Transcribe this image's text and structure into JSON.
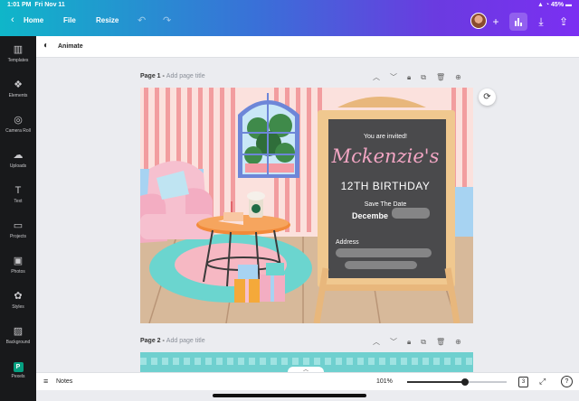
{
  "status": {
    "time": "1:01 PM",
    "date": "Fri Nov 11",
    "battery": "45%"
  },
  "topbar": {
    "back_icon": "chevron-left-icon",
    "home_label": "Home",
    "file_label": "File",
    "resize_label": "Resize",
    "undo_icon": "undo-icon",
    "redo_icon": "redo-icon",
    "add_icon": "plus-icon",
    "insights_icon": "bar-chart-icon",
    "download_icon": "download-icon",
    "share_icon": "share-icon"
  },
  "sidebar": {
    "items": [
      {
        "label": "Templates",
        "icon": "templates-icon"
      },
      {
        "label": "Elements",
        "icon": "elements-icon"
      },
      {
        "label": "Camera Roll",
        "icon": "camera-icon"
      },
      {
        "label": "Uploads",
        "icon": "cloud-upload-icon"
      },
      {
        "label": "Text",
        "icon": "text-icon"
      },
      {
        "label": "Projects",
        "icon": "folder-icon"
      },
      {
        "label": "Photos",
        "icon": "image-icon"
      },
      {
        "label": "Styles",
        "icon": "palette-icon"
      },
      {
        "label": "Background",
        "icon": "background-icon"
      },
      {
        "label": "Pexels",
        "icon": "pexels-icon"
      }
    ]
  },
  "animate": {
    "label": "Animate"
  },
  "pages": [
    {
      "name": "Page 1 - ",
      "title_placeholder": "Add page title"
    },
    {
      "name": "Page 2 - ",
      "title_placeholder": "Add page title"
    }
  ],
  "invite": {
    "intro": "You are invited!",
    "name": "Mckenzie's",
    "event": "12TH BIRTHDAY",
    "save_the_date": "Save The Date",
    "date_prefix": "Decembe",
    "address_label": "Address"
  },
  "bottombar": {
    "notes_label": "Notes",
    "zoom": "101%",
    "zoom_fraction": 0.58,
    "page_count": "3",
    "help": "?"
  },
  "colors": {
    "accent_start": "#0fb6c9",
    "accent_end": "#7b2ff2",
    "chalkboard": "#4a4a4c",
    "name_pink": "#f3a6c4"
  }
}
